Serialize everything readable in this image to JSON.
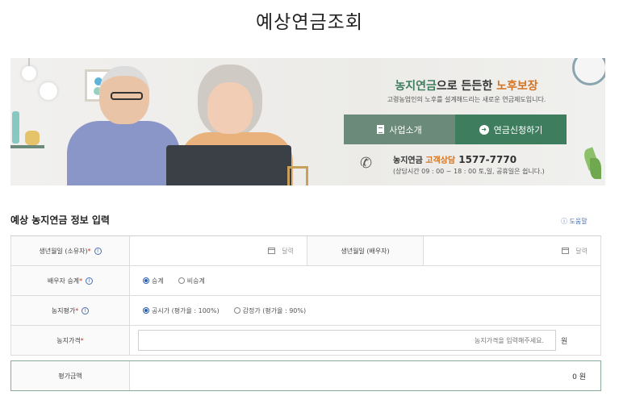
{
  "page": {
    "title": "예상연금조회"
  },
  "banner": {
    "title_part1": "농지연금",
    "title_part2": "으로 든든한 ",
    "title_part3": "노후보장",
    "subtitle": "고령농업인의 노후를 설계해드리는 새로운 연금제도입니다.",
    "intro_button": "사업소개",
    "apply_button": "연금신청하기",
    "consult_label1": "농지연금 ",
    "consult_label2": "고객상담",
    "consult_number": " 1577-7770",
    "consult_hours": "(상담시간 09 : 00 ~ 18 : 00 토,일, 공휴일은 쉽니다.)"
  },
  "section": {
    "title": "예상 농지연금 정보 입력",
    "help": "ⓘ 도움말"
  },
  "form": {
    "birth_owner_label": "생년월일 (소유자)",
    "birth_spouse_label": "생년월일 (배우자)",
    "calendar_text": "달력",
    "spouse_succession_label": "배우자 승계",
    "succession_options": [
      "승계",
      "비승계"
    ],
    "farm_valuation_label": "농지평가",
    "valuation_options": [
      "공시가 (평가율 : 100%)",
      "감정가 (평가율 : 90%)"
    ],
    "farm_price_label": "농지가격",
    "farm_price_placeholder": "농지가격을 입력해주세요.",
    "won_unit": "원"
  },
  "result": {
    "label": "평가금액",
    "value": "0 원"
  },
  "colors": {
    "accent_green": "#3e7e5f",
    "muted_green": "#6b8a79",
    "orange": "#d6731e",
    "link_blue": "#4a6fb0"
  }
}
